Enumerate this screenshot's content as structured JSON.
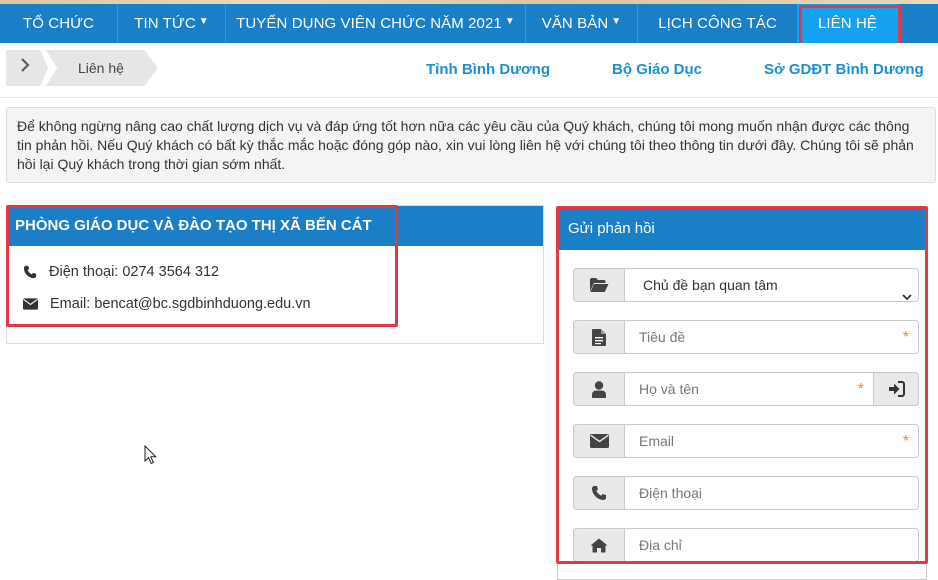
{
  "nav": {
    "items": [
      {
        "label": "TỔ CHỨC",
        "dropdown": false
      },
      {
        "label": "TIN TỨC",
        "dropdown": true
      },
      {
        "label": "TUYỂN DỤNG VIÊN CHỨC NĂM 2021",
        "dropdown": true
      },
      {
        "label": "VĂN BẢN",
        "dropdown": true
      },
      {
        "label": "LỊCH CÔNG TÁC",
        "dropdown": false
      },
      {
        "label": "LIÊN HỆ",
        "dropdown": false,
        "active": true
      }
    ]
  },
  "breadcrumb": {
    "home_icon": "chevron-right-icon",
    "current": "Liên hệ"
  },
  "quick_links": [
    "Tỉnh Bình Dương",
    "Bộ Giáo Dục",
    "Sở GDĐT Bình Dương"
  ],
  "intro_text": "Để không ngừng nâng cao chất lượng dịch vụ và đáp ứng tốt hơn nữa các yêu cầu của Quý khách, chúng tôi mong muốn nhận được các thông tin phản hồi. Nếu Quý khách có bất kỳ thắc mắc hoặc đóng góp nào, xin vui lòng liên hệ với chúng tôi theo thông tin dưới đây. Chúng tôi sẽ phản hồi lại Quý khách trong thời gian sớm nhất.",
  "contact": {
    "title": "PHÒNG GIÁO DỤC VÀ ĐÀO TẠO THỊ XÃ BẾN CÁT",
    "phone": "Điện thoại: 0274 3564 312",
    "email": "Email: bencat@bc.sgdbinhduong.edu.vn"
  },
  "feedback_form": {
    "title": "Gửi phản hồi",
    "topic_select": "Chủ đề bạn quan tâm",
    "subject_placeholder": "Tiêu đề",
    "name_placeholder": "Họ và tên",
    "email_placeholder": "Email",
    "phone_placeholder": "Điện thoại",
    "address_placeholder": "Địa chỉ",
    "required_mark": "*"
  },
  "colors": {
    "nav_bg": "#1a7fc6",
    "nav_active": "#15a0f0",
    "highlight_border": "#e03a48",
    "link": "#1a8fd8",
    "required": "#f08a24"
  }
}
